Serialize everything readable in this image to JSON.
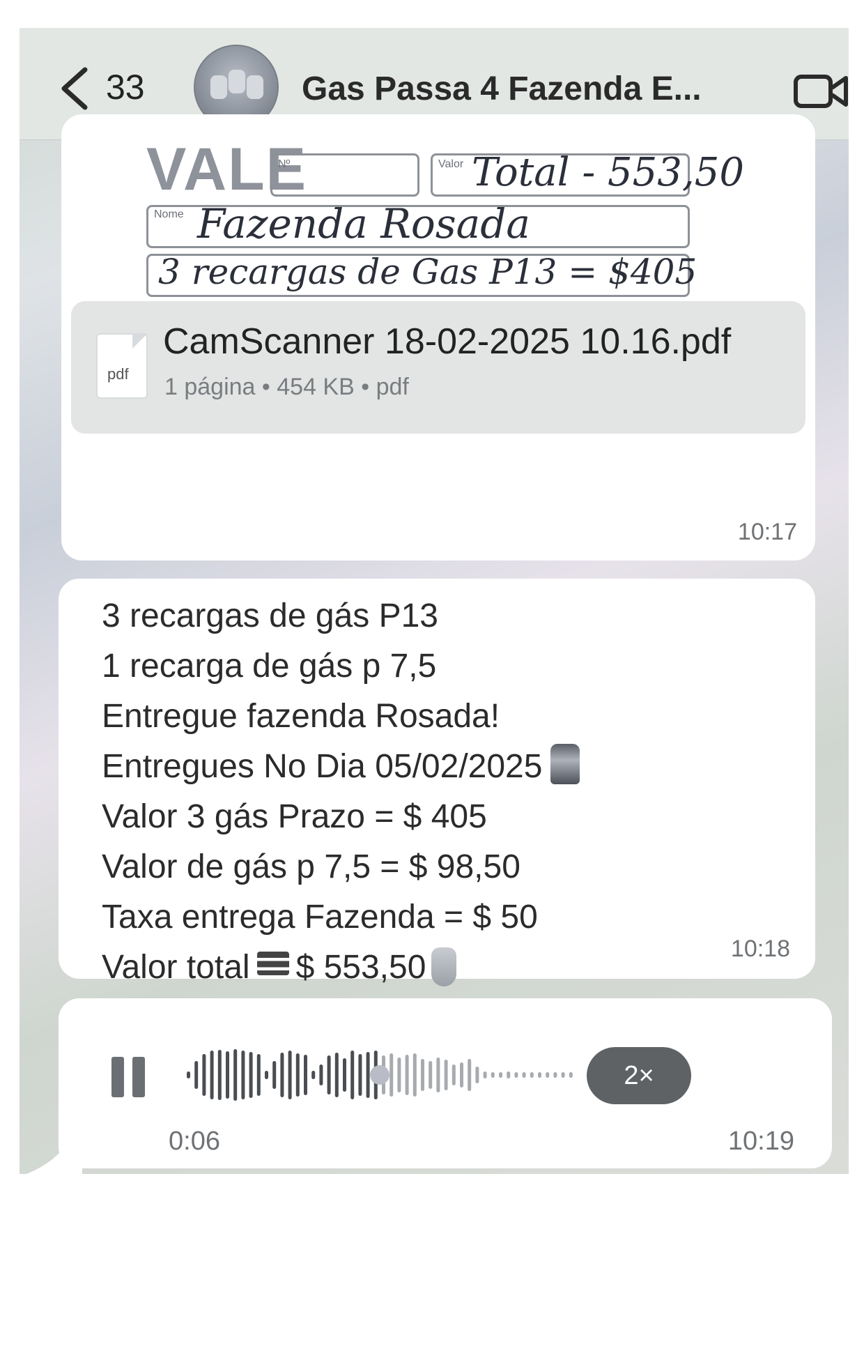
{
  "header": {
    "back_count": "33",
    "chat_title": "Gas Passa 4 Fazenda E...",
    "back_icon": "chevron-left-icon",
    "video_icon": "video-camera-icon"
  },
  "document_message": {
    "scan_preview": {
      "heading": "VALE",
      "number_label": "Nº",
      "value_label": "Valor",
      "name_label": "Nome",
      "handwritten_value": "Total - 553,50",
      "handwritten_name": "Fazenda Rosada",
      "handwritten_description": "3 recargas de Gas P13 = $405"
    },
    "file_name": "CamScanner 18-02-2025 10.16.pdf",
    "file_icon_label": "pdf",
    "file_meta": "1 página • 454 KB • pdf",
    "time": "10:17"
  },
  "text_message": {
    "lines": [
      "3 recargas de gás P13",
      "1 recarga de gás p 7,5",
      "Entregue fazenda Rosada!",
      "Entregues No Dia 05/02/2025",
      "Valor 3 gás Prazo = $ 405",
      "Valor de gás p 7,5 = $ 98,50",
      "Taxa entrega Fazenda = $ 50",
      "Valor total",
      "$ 553,50"
    ],
    "time": "10:18"
  },
  "audio_message": {
    "pause_icon": "pause-icon",
    "playback_speed": "2×",
    "elapsed": "0:06",
    "progress": 0.5,
    "time": "10:19"
  },
  "colors": {
    "bubble": "#ffffff",
    "header": "#e3e7e4",
    "speed_pill": "#5f6265",
    "meta_text": "#6f7275"
  }
}
